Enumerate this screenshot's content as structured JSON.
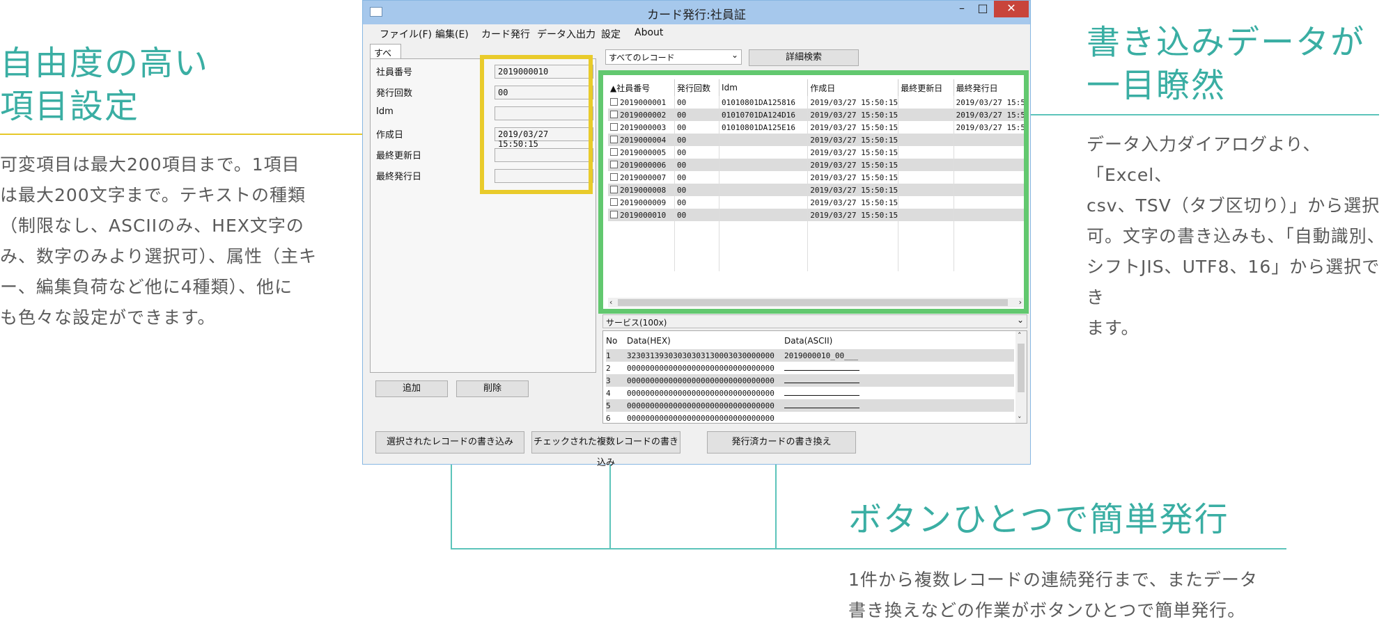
{
  "callouts": {
    "left": {
      "title_line1": "自由度の高い",
      "title_line2": "項目設定",
      "desc": [
        "可変項目は最大200項目まで。1項目",
        "は最大200文字まで。テキストの種類",
        "（制限なし、ASCIIのみ、HEX文字の",
        "み、数字のみより選択可）、属性（主キ",
        "ー、編集負荷など他に4種類）、他に",
        "も色々な設定ができます。"
      ]
    },
    "right": {
      "title_line1": "書き込みデータが",
      "title_line2": "一目瞭然",
      "desc": [
        "データ入力ダイアログより、「Excel、",
        "csv、TSV（タブ区切り）」から選択",
        "可。文字の書き込みも、「自動識別、",
        "シフトJIS、UTF8、16」から選択でき",
        "ます。"
      ]
    },
    "bottom": {
      "title": "ボタンひとつで簡単発行",
      "desc": [
        "1件から複数レコードの連続発行まで、またデータ",
        "書き換えなどの作業がボタンひとつで簡単発行。"
      ]
    }
  },
  "window": {
    "title": "カード発行:社員証",
    "min": "–",
    "max": "□",
    "close": "✕",
    "menu": [
      "ファイル(F)",
      "編集(E)",
      "カード発行",
      "データ入出力",
      "設定",
      "About"
    ],
    "tab": "すべて",
    "fields": [
      {
        "label": "社員番号",
        "value": "2019000010"
      },
      {
        "label": "発行回数",
        "value": "00"
      },
      {
        "label": "Idm",
        "value": ""
      },
      {
        "label": "作成日",
        "value": "2019/03/27 15:50:15"
      },
      {
        "label": "最終更新日",
        "value": ""
      },
      {
        "label": "最終発行日",
        "value": ""
      }
    ],
    "add_button": "追加",
    "delete_button": "削除",
    "record_filter": "すべてのレコード",
    "detail_search": "詳細検索",
    "grid": {
      "headers": [
        "▲社員番号",
        "発行回数",
        "Idm",
        "作成日",
        "最終更新日",
        "最終発行日"
      ],
      "rows": [
        [
          "2019000001",
          "00",
          "01010801DA125816",
          "2019/03/27 15:50:15",
          "",
          "2019/03/27 15:5"
        ],
        [
          "2019000002",
          "00",
          "01010701DA124D16",
          "2019/03/27 15:50:15",
          "",
          "2019/03/27 15:5"
        ],
        [
          "2019000003",
          "00",
          "01010801DA125E16",
          "2019/03/27 15:50:15",
          "",
          "2019/03/27 15:5"
        ],
        [
          "2019000004",
          "00",
          "",
          "2019/03/27 15:50:15",
          "",
          ""
        ],
        [
          "2019000005",
          "00",
          "",
          "2019/03/27 15:50:15",
          "",
          ""
        ],
        [
          "2019000006",
          "00",
          "",
          "2019/03/27 15:50:15",
          "",
          ""
        ],
        [
          "2019000007",
          "00",
          "",
          "2019/03/27 15:50:15",
          "",
          ""
        ],
        [
          "2019000008",
          "00",
          "",
          "2019/03/27 15:50:15",
          "",
          ""
        ],
        [
          "2019000009",
          "00",
          "",
          "2019/03/27 15:50:15",
          "",
          ""
        ],
        [
          "2019000010",
          "00",
          "",
          "2019/03/27 15:50:15",
          "",
          ""
        ]
      ]
    },
    "service_label": "サービス(100x)",
    "service": {
      "headers": [
        "No",
        "Data(HEX)",
        "Data(ASCII)"
      ],
      "rows": [
        [
          "1",
          "32303139303030303130003030000000",
          "2019000010_00___"
        ],
        [
          "2",
          "00000000000000000000000000000000",
          ""
        ],
        [
          "3",
          "00000000000000000000000000000000",
          ""
        ],
        [
          "4",
          "00000000000000000000000000000000",
          ""
        ],
        [
          "5",
          "00000000000000000000000000000000",
          ""
        ],
        [
          "6",
          "00000000000000000000000000000000",
          ""
        ]
      ]
    },
    "bottom_buttons": [
      "選択されたレコードの書き込み",
      "チェックされた複数レコードの書き込み",
      "発行済カードの書き換え"
    ]
  }
}
